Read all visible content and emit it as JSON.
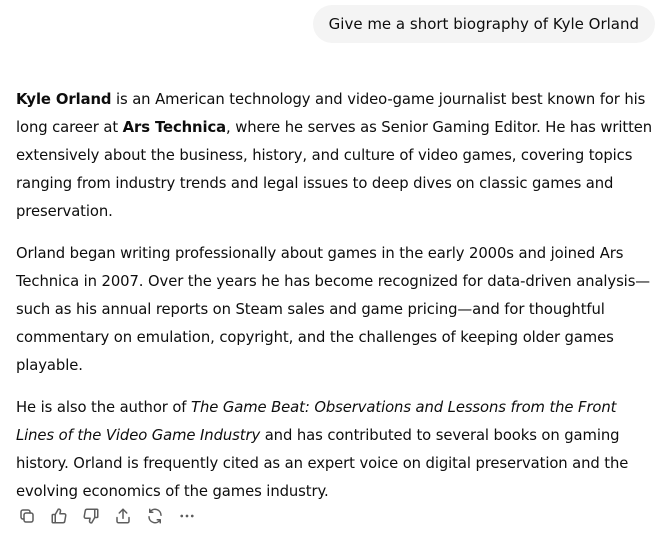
{
  "user_message": "Give me a short biography of Kyle Orland",
  "response": {
    "p1": {
      "name": "Kyle Orland",
      "t1": " is an American technology and video-game journalist best known for his long career at ",
      "outlet": "Ars Technica",
      "t2": ", where he serves as Senior Gaming Editor. He has written extensively about the business, history, and culture of video games, covering topics ranging from industry trends and legal issues to deep dives on classic games and preservation."
    },
    "p2": "Orland began writing professionally about games in the early 2000s and joined Ars Technica in 2007. Over the years he has become recognized for data-driven analysis—such as his annual reports on Steam sales and game pricing—and for thoughtful commentary on emulation, copyright, and the challenges of keeping older games playable.",
    "p3": {
      "t1": "He is also the author of ",
      "book": "The Game Beat: Observations and Lessons from the Front Lines of the Video Game Industry",
      "t2": " and has contributed to several books on gaming history. Orland is frequently cited as an expert voice on digital preservation and the evolving economics of the games industry."
    }
  },
  "actions": {
    "icons": [
      "copy-icon",
      "thumbs-up-icon",
      "thumbs-down-icon",
      "share-icon",
      "regenerate-icon",
      "more-icon"
    ],
    "icon_color": "#5d5d5d"
  }
}
